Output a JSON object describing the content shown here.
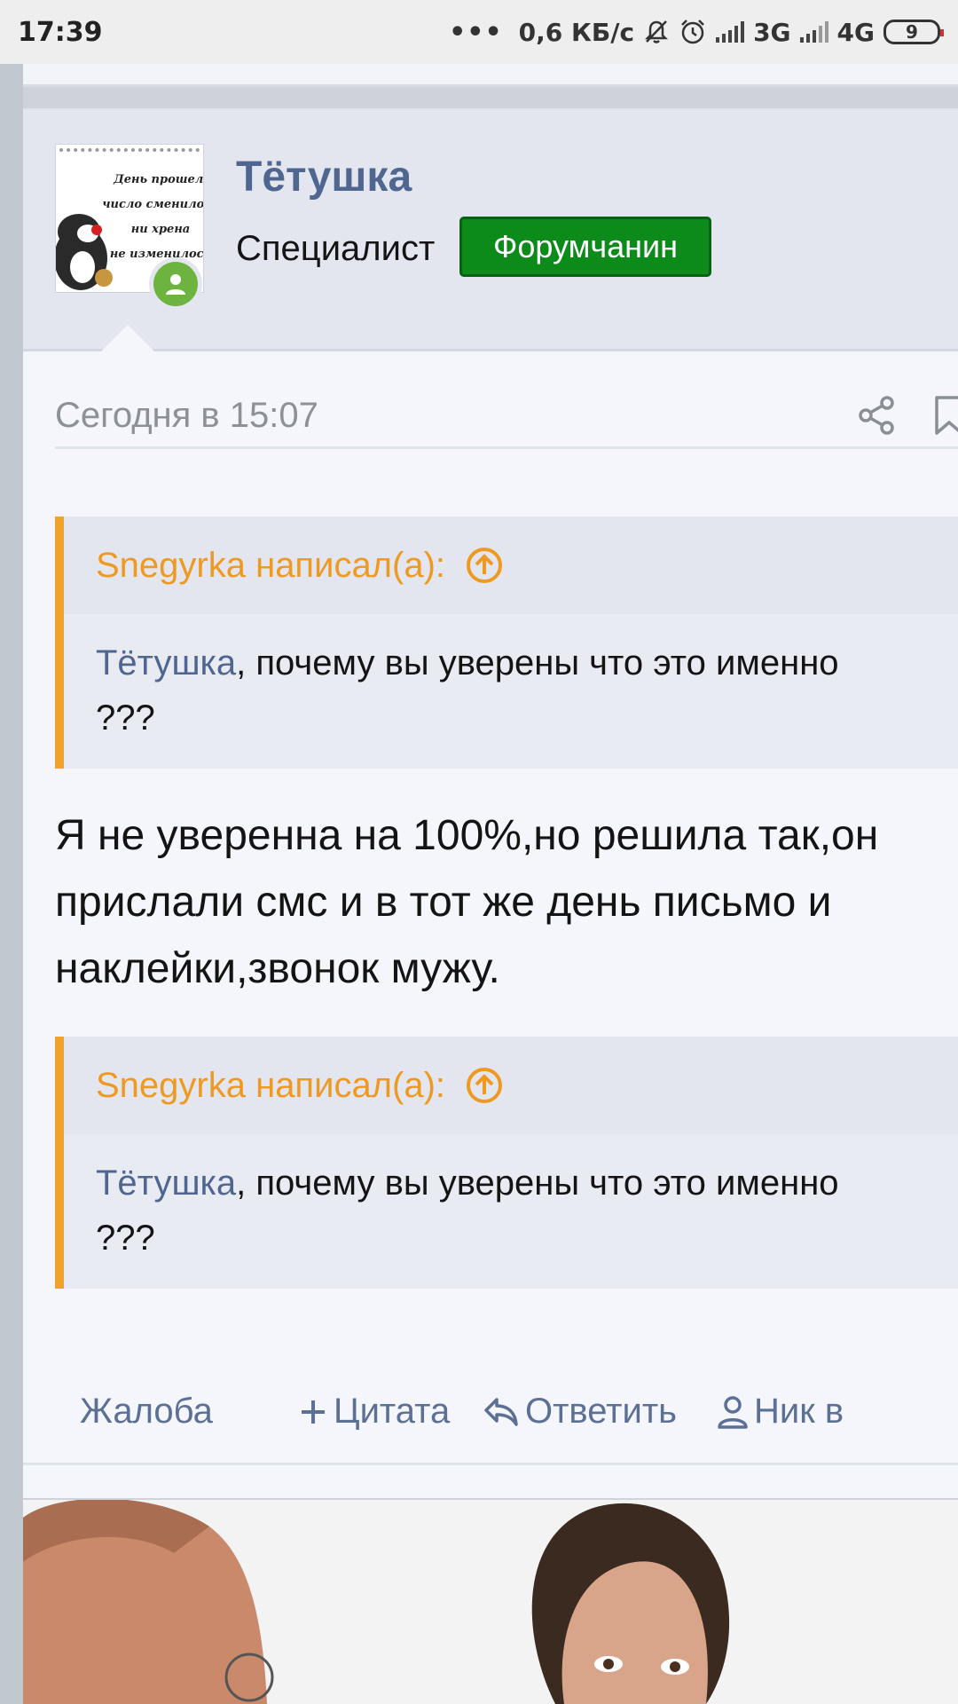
{
  "status_bar": {
    "time": "17:39",
    "network_speed": "0,6 КБ/с",
    "sim1_network": "3G",
    "sim2_network": "4G",
    "battery": "9",
    "icons": [
      "more-dots-icon",
      "notifications-muted-icon",
      "alarm-icon",
      "signal-icon",
      "signal-icon",
      "battery-icon"
    ]
  },
  "post": {
    "author": {
      "name": "Тётушка",
      "title": "Специалист",
      "badge": "Форумчанин",
      "badge_color": "#0c8a1a",
      "online": true,
      "avatar_caption": [
        "День прошел,",
        "число сменилось",
        "ни хрена",
        "не изменилось"
      ]
    },
    "date": "Сегодня в 15:07",
    "quotes": [
      {
        "author_line": "Snegyrka написал(а):",
        "mention": "Тётушка",
        "text": ", почему вы уверены что это именно",
        "text_cont": "???"
      },
      {
        "author_line": "Snegyrka написал(а):",
        "mention": "Тётушка",
        "text": ", почему вы уверены что это именно",
        "text_cont": "???"
      }
    ],
    "body_lines": [
      "Я не уверенна на 100%,но решила так,он",
      "прислали смс и в тот же день письмо и",
      "наклейки,звонок мужу."
    ],
    "actions": {
      "report": "Жалоба",
      "quote": "Цитата",
      "reply": "Ответить",
      "mention": "Ник в"
    }
  },
  "colors": {
    "accent_link": "#4f6690",
    "quote_accent": "#f0a22d",
    "action_text": "#5c6f94"
  }
}
